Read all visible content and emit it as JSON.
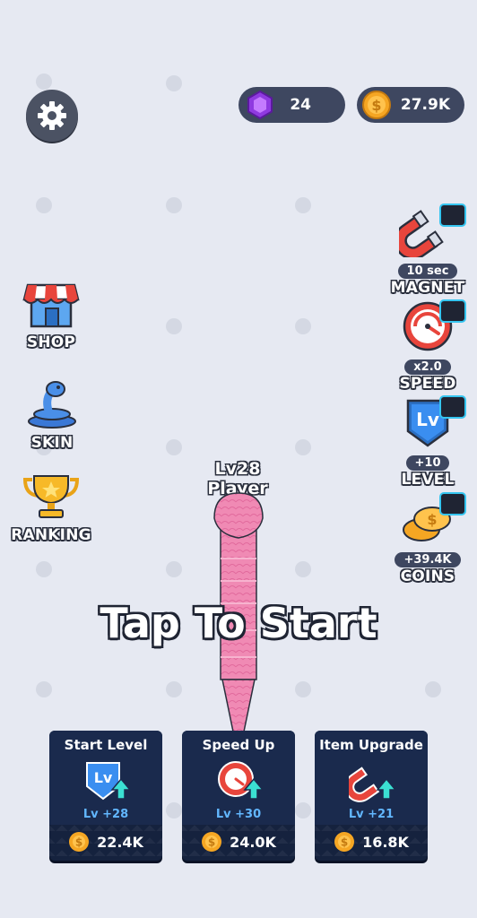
{
  "currency": {
    "gems": "24",
    "coins": "27.9K"
  },
  "menu": {
    "shop": "SHOP",
    "skin": "SKIN",
    "ranking": "RANKING"
  },
  "bonuses": {
    "magnet": {
      "chip": "10 sec",
      "label": "MAGNET"
    },
    "speed": {
      "chip": "x2.0",
      "label": "SPEED"
    },
    "level": {
      "chip": "+10",
      "label": "LEVEL"
    },
    "coins": {
      "chip": "+39.4K",
      "label": "COINS"
    }
  },
  "player": {
    "level": "Lv28",
    "name": "Player"
  },
  "prompt": "Tap To Start",
  "upgrades": [
    {
      "title": "Start Level",
      "level": "Lv +28",
      "cost": "22.4K"
    },
    {
      "title": "Speed Up",
      "level": "Lv +30",
      "cost": "24.0K"
    },
    {
      "title": "Item Upgrade",
      "level": "Lv +21",
      "cost": "16.8K"
    }
  ],
  "colors": {
    "background": "#e6e9f2",
    "snake": "#f08ab4",
    "card": "#15223e",
    "levelText": "#62b7ff",
    "coin": "#f5a623",
    "gem": "#a64cff"
  }
}
